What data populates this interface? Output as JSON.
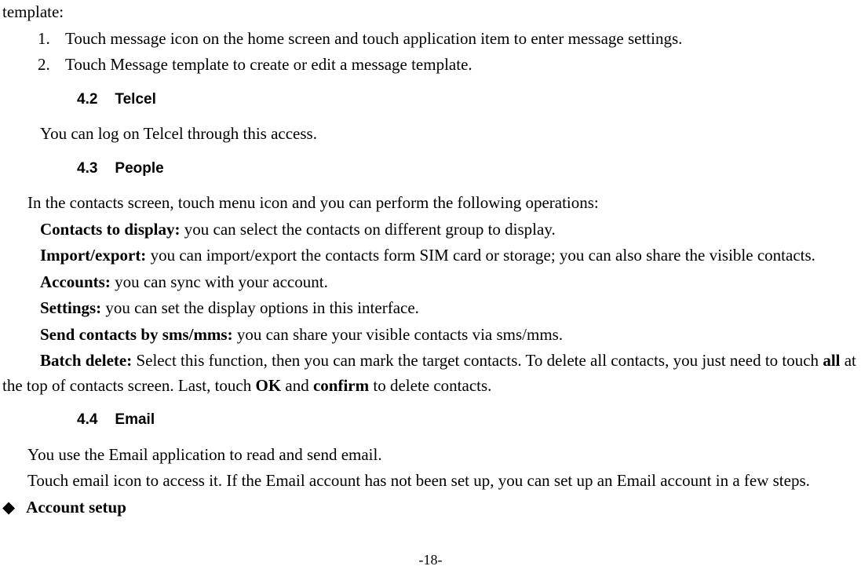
{
  "template_label": "template:",
  "list_items": [
    {
      "num": "1.",
      "text": "Touch message icon on the home screen and touch application item to enter message settings."
    },
    {
      "num": "2.",
      "text": "Touch Message template to create or edit a message template."
    }
  ],
  "sections": {
    "telcel": {
      "number": "4.2",
      "title": "Telcel",
      "body": "You can log on Telcel through this access."
    },
    "people": {
      "number": "4.3",
      "title": "People",
      "intro": "In the contacts screen, touch menu icon and you can perform the following operations:",
      "op1_label": "Contacts to display:",
      "op1_text": " you can select the contacts on different group to display.",
      "op2_label": "Import/export:",
      "op2_text": " you can import/export the contacts form SIM card or storage; you can also share the visible contacts.",
      "op3_label": "Accounts:",
      "op3_text": " you can sync with your account.",
      "op4_label": "Settings:",
      "op4_text": " you can set the display options in this interface.",
      "op5_label": "Send contacts by sms/mms:",
      "op5_text": " you can share your visible contacts via sms/mms.",
      "op6_label": "Batch delete:",
      "op6_text_a": " Select this function, then you can mark the target contacts. To delete all contacts, you just need to touch ",
      "op6_bold_all": "all",
      "op6_text_b": " at the top of contacts screen. Last, touch ",
      "op6_bold_ok": "OK",
      "op6_text_c": " and ",
      "op6_bold_confirm": "confirm",
      "op6_text_d": " to delete contacts."
    },
    "email": {
      "number": "4.4",
      "title": "Email",
      "para1": "You use the Email application to read and send email.",
      "para2": "Touch email icon to access it. If the Email account has not been set up, you can set up an Email account in a few steps.",
      "account_setup": "Account setup"
    }
  },
  "page_number": "-18-"
}
